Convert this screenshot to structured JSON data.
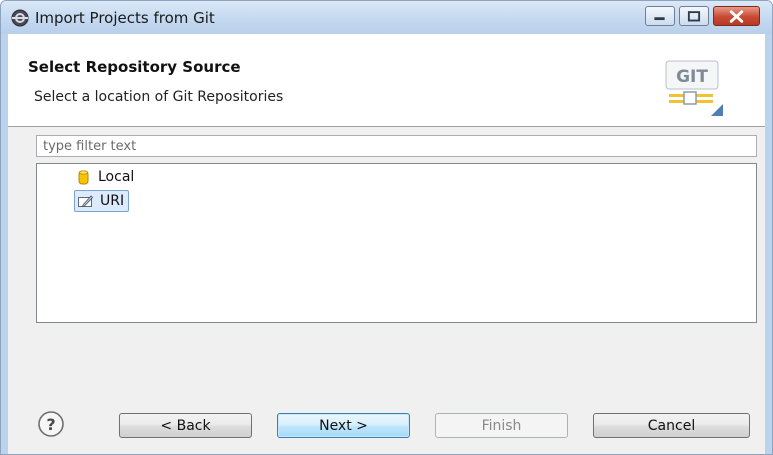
{
  "window": {
    "title": "Import Projects from Git",
    "app_icon": "eclipse-icon",
    "controls": [
      "minimize-icon",
      "maximize-icon",
      "close-icon"
    ]
  },
  "banner": {
    "title": "Select Repository Source",
    "subtitle": "Select a location of Git Repositories",
    "logo_text": "GIT"
  },
  "filter": {
    "placeholder": "type filter text",
    "value": ""
  },
  "tree": {
    "items": [
      {
        "label": "Local",
        "icon": "repository-cylinder-icon",
        "selected": false
      },
      {
        "label": "URI",
        "icon": "uri-edit-icon",
        "selected": true
      }
    ]
  },
  "buttons": {
    "help_icon": "help-icon",
    "back": "< Back",
    "next": "Next >",
    "finish": "Finish",
    "cancel": "Cancel"
  },
  "colors": {
    "titlebar": "#c6daf1",
    "close_button": "#c94a33",
    "selection": "#dbeafc",
    "default_button_border": "#3c7fb1"
  }
}
